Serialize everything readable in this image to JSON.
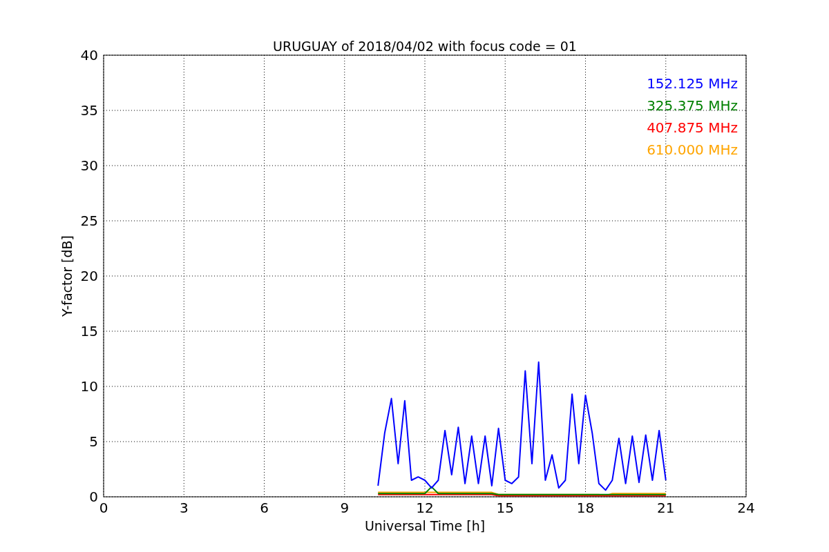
{
  "chart_data": {
    "type": "line",
    "title": "URUGUAY of 2018/04/02 with focus code = 01",
    "xlabel": "Universal Time [h]",
    "ylabel": "Y-factor [dB]",
    "x": [
      10.25,
      10.5,
      10.75,
      11,
      11.25,
      11.5,
      11.75,
      12,
      12.25,
      12.5,
      12.75,
      13,
      13.25,
      13.5,
      13.75,
      14,
      14.25,
      14.5,
      14.75,
      15,
      15.25,
      15.5,
      15.75,
      16,
      16.25,
      16.5,
      16.75,
      17,
      17.25,
      17.5,
      17.75,
      18,
      18.25,
      18.5,
      18.75,
      19,
      19.25,
      19.5,
      19.75,
      20,
      20.25,
      20.5,
      20.75,
      21
    ],
    "series": [
      {
        "name": "152.125 MHz",
        "color": "#0000ff",
        "values": [
          1.0,
          5.8,
          8.9,
          3.0,
          8.7,
          1.5,
          1.8,
          1.5,
          0.8,
          1.5,
          6.0,
          2.0,
          6.3,
          1.2,
          5.5,
          1.2,
          5.5,
          1.0,
          6.2,
          1.5,
          1.2,
          1.8,
          11.4,
          3.0,
          12.2,
          1.5,
          3.8,
          0.8,
          1.5,
          9.3,
          3.0,
          9.2,
          5.8,
          1.2,
          0.6,
          1.5,
          5.3,
          1.2,
          5.5,
          1.3,
          5.6,
          1.5,
          6.0,
          1.5
        ]
      },
      {
        "name": "325.375 MHz",
        "color": "#008000",
        "values": [
          0.3,
          0.3,
          0.3,
          0.3,
          0.3,
          0.3,
          0.3,
          0.3,
          0.9,
          0.3,
          0.3,
          0.3,
          0.3,
          0.3,
          0.3,
          0.3,
          0.3,
          0.3,
          0.2,
          0.2,
          0.2,
          0.2,
          0.2,
          0.2,
          0.2,
          0.2,
          0.2,
          0.2,
          0.2,
          0.2,
          0.2,
          0.2,
          0.2,
          0.2,
          0.2,
          0.2,
          0.2,
          0.2,
          0.2,
          0.2,
          0.2,
          0.2,
          0.2,
          0.2
        ]
      },
      {
        "name": "407.875 MHz",
        "color": "#ff0000",
        "values": [
          0.2,
          0.2,
          0.2,
          0.2,
          0.2,
          0.2,
          0.2,
          0.2,
          0.2,
          0.2,
          0.2,
          0.2,
          0.2,
          0.2,
          0.2,
          0.2,
          0.2,
          0.2,
          0.1,
          0.1,
          0.1,
          0.1,
          0.1,
          0.1,
          0.1,
          0.1,
          0.1,
          0.1,
          0.1,
          0.1,
          0.1,
          0.1,
          0.1,
          0.1,
          0.1,
          0.1,
          0.1,
          0.1,
          0.1,
          0.1,
          0.1,
          0.1,
          0.1,
          0.1
        ]
      },
      {
        "name": "610.000 MHz",
        "color": "#ffa500",
        "values": [
          0.4,
          0.4,
          0.4,
          0.4,
          0.4,
          0.4,
          0.4,
          0.4,
          0.4,
          0.4,
          0.4,
          0.4,
          0.4,
          0.4,
          0.4,
          0.4,
          0.4,
          0.4,
          0.2,
          0.2,
          0.2,
          0.2,
          0.2,
          0.2,
          0.2,
          0.2,
          0.2,
          0.2,
          0.2,
          0.2,
          0.2,
          0.2,
          0.2,
          0.2,
          0.1,
          0.3,
          0.3,
          0.3,
          0.3,
          0.3,
          0.3,
          0.3,
          0.3,
          0.3
        ]
      }
    ],
    "xlim": [
      0,
      24
    ],
    "ylim": [
      0,
      40
    ],
    "xticks": [
      0,
      3,
      6,
      9,
      12,
      15,
      18,
      21,
      24
    ],
    "yticks": [
      0,
      5,
      10,
      15,
      20,
      25,
      30,
      35,
      40
    ],
    "grid": true
  }
}
